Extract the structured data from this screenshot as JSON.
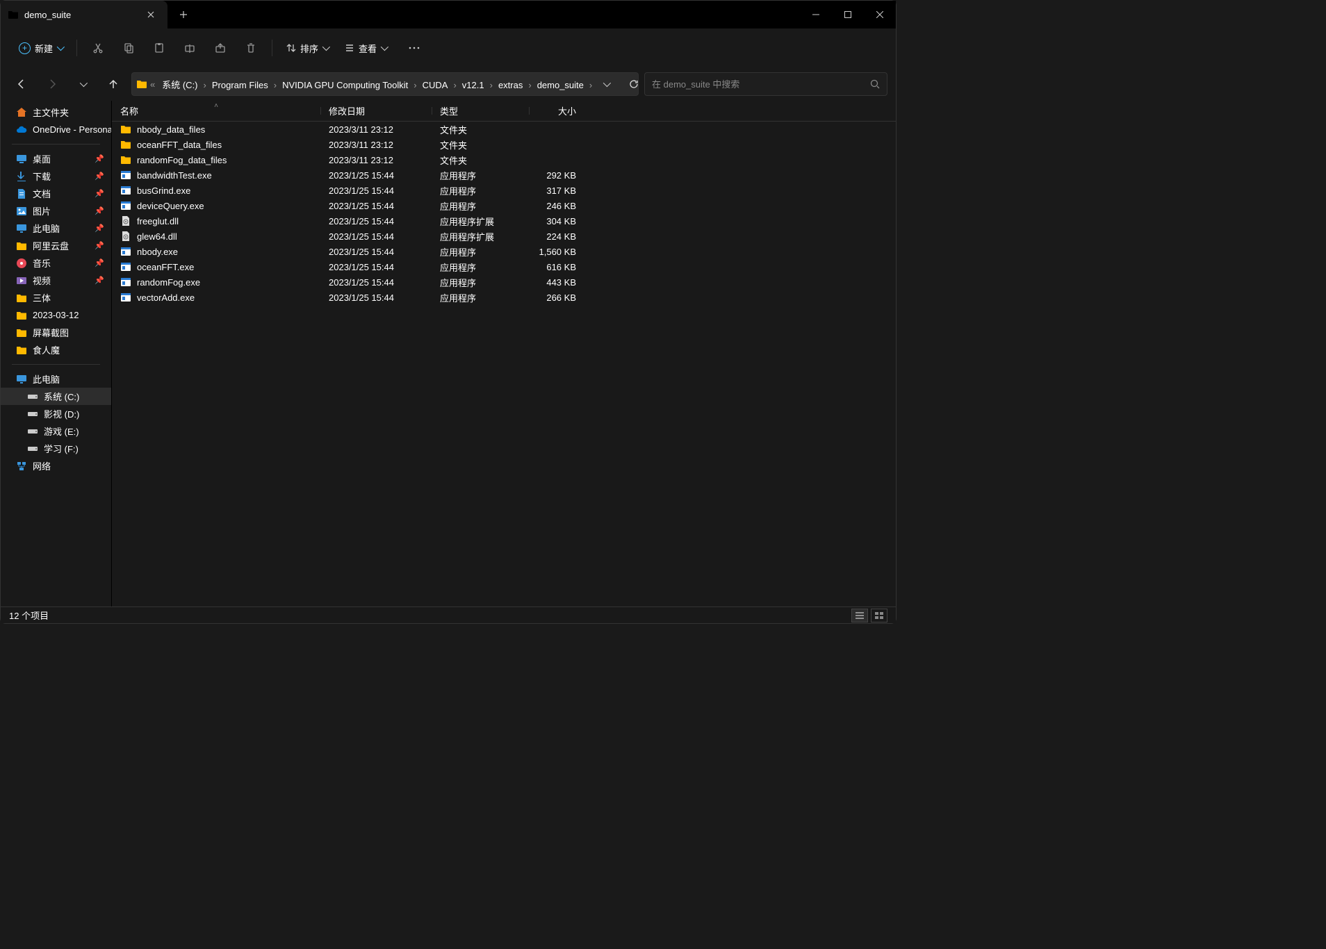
{
  "window": {
    "title": "demo_suite"
  },
  "toolbar": {
    "new_label": "新建",
    "sort_label": "排序",
    "view_label": "查看"
  },
  "breadcrumb": [
    "系统 (C:)",
    "Program Files",
    "NVIDIA GPU Computing Toolkit",
    "CUDA",
    "v12.1",
    "extras",
    "demo_suite"
  ],
  "search": {
    "placeholder": "在 demo_suite 中搜索"
  },
  "sidebar": {
    "top": [
      {
        "label": "主文件夹",
        "icon": "home",
        "color": "#e57325"
      },
      {
        "label": "OneDrive - Personal",
        "icon": "cloud",
        "color": "#0078d4"
      }
    ],
    "quick": [
      {
        "label": "桌面",
        "icon": "desktop",
        "pinned": true,
        "color": "#3a96dd"
      },
      {
        "label": "下载",
        "icon": "download",
        "pinned": true,
        "color": "#3a96dd"
      },
      {
        "label": "文档",
        "icon": "doc",
        "pinned": true,
        "color": "#3a96dd"
      },
      {
        "label": "图片",
        "icon": "pic",
        "pinned": true,
        "color": "#3a96dd"
      },
      {
        "label": "此电脑",
        "icon": "pc",
        "pinned": true,
        "color": "#3a96dd"
      },
      {
        "label": "阿里云盘",
        "icon": "folder",
        "pinned": true,
        "color": "#ffb900"
      },
      {
        "label": "音乐",
        "icon": "music",
        "pinned": true,
        "color": "#e74856"
      },
      {
        "label": "视频",
        "icon": "video",
        "pinned": true,
        "color": "#8764b8"
      },
      {
        "label": "三体",
        "icon": "folder",
        "pinned": false,
        "color": "#ffb900"
      },
      {
        "label": "2023-03-12",
        "icon": "folder",
        "pinned": false,
        "color": "#ffb900"
      },
      {
        "label": "屏幕截图",
        "icon": "folder",
        "pinned": false,
        "color": "#ffb900"
      },
      {
        "label": "食人魔",
        "icon": "folder",
        "pinned": false,
        "color": "#ffb900"
      }
    ],
    "pc": {
      "label": "此电脑",
      "icon": "pc",
      "color": "#3a96dd"
    },
    "drives": [
      {
        "label": "系统 (C:)",
        "selected": true
      },
      {
        "label": "影视 (D:)"
      },
      {
        "label": "游戏 (E:)"
      },
      {
        "label": "学习 (F:)"
      }
    ],
    "network": {
      "label": "网络",
      "icon": "network",
      "color": "#3a96dd"
    }
  },
  "columns": {
    "name": "名称",
    "date": "修改日期",
    "type": "类型",
    "size": "大小"
  },
  "files": [
    {
      "name": "nbody_data_files",
      "date": "2023/3/11 23:12",
      "type": "文件夹",
      "size": "",
      "icon": "folder"
    },
    {
      "name": "oceanFFT_data_files",
      "date": "2023/3/11 23:12",
      "type": "文件夹",
      "size": "",
      "icon": "folder"
    },
    {
      "name": "randomFog_data_files",
      "date": "2023/3/11 23:12",
      "type": "文件夹",
      "size": "",
      "icon": "folder"
    },
    {
      "name": "bandwidthTest.exe",
      "date": "2023/1/25 15:44",
      "type": "应用程序",
      "size": "292 KB",
      "icon": "exe"
    },
    {
      "name": "busGrind.exe",
      "date": "2023/1/25 15:44",
      "type": "应用程序",
      "size": "317 KB",
      "icon": "exe"
    },
    {
      "name": "deviceQuery.exe",
      "date": "2023/1/25 15:44",
      "type": "应用程序",
      "size": "246 KB",
      "icon": "exe"
    },
    {
      "name": "freeglut.dll",
      "date": "2023/1/25 15:44",
      "type": "应用程序扩展",
      "size": "304 KB",
      "icon": "dll"
    },
    {
      "name": "glew64.dll",
      "date": "2023/1/25 15:44",
      "type": "应用程序扩展",
      "size": "224 KB",
      "icon": "dll"
    },
    {
      "name": "nbody.exe",
      "date": "2023/1/25 15:44",
      "type": "应用程序",
      "size": "1,560 KB",
      "icon": "exe"
    },
    {
      "name": "oceanFFT.exe",
      "date": "2023/1/25 15:44",
      "type": "应用程序",
      "size": "616 KB",
      "icon": "exe"
    },
    {
      "name": "randomFog.exe",
      "date": "2023/1/25 15:44",
      "type": "应用程序",
      "size": "443 KB",
      "icon": "exe"
    },
    {
      "name": "vectorAdd.exe",
      "date": "2023/1/25 15:44",
      "type": "应用程序",
      "size": "266 KB",
      "icon": "exe"
    }
  ],
  "status": {
    "items": "12 个项目"
  }
}
